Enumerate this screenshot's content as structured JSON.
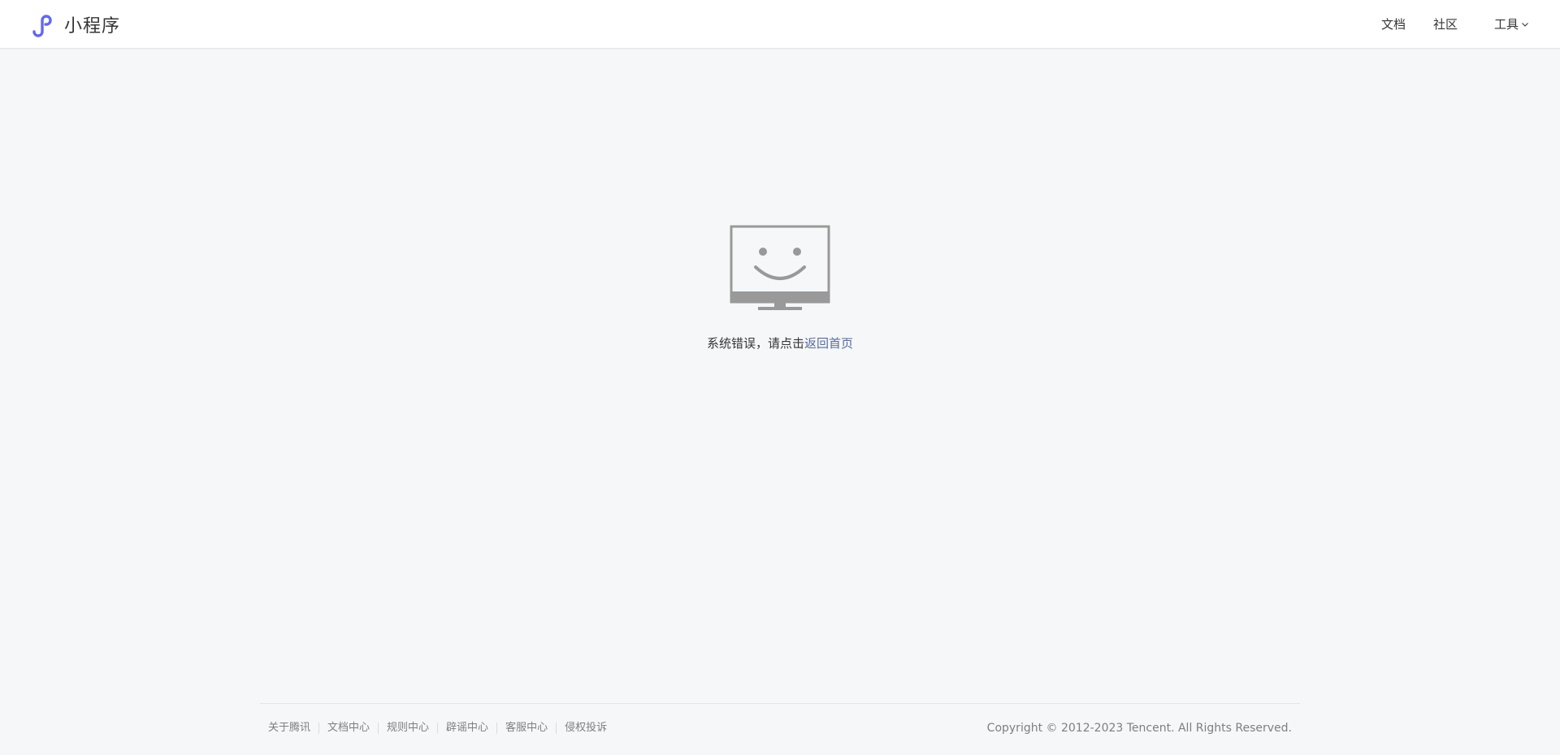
{
  "header": {
    "logo_text": "小程序",
    "nav": {
      "docs": "文档",
      "community": "社区",
      "tools": "工具"
    }
  },
  "error": {
    "message_prefix": "系统错误，请点击",
    "home_link": "返回首页"
  },
  "footer": {
    "links": [
      "关于腾讯",
      "文档中心",
      "规则中心",
      "辟谣中心",
      "客服中心",
      "侵权投诉"
    ],
    "copyright": "Copyright © 2012-2023 Tencent. All Rights Reserved."
  },
  "colors": {
    "brand_logo": "#6467f0",
    "link": "#576b95",
    "background": "#f6f7f9",
    "icon_gray": "#999999"
  },
  "icons": {
    "logo": "mini-program-logo-icon",
    "chevron": "chevron-down-icon",
    "error": "smiling-monitor-icon"
  }
}
